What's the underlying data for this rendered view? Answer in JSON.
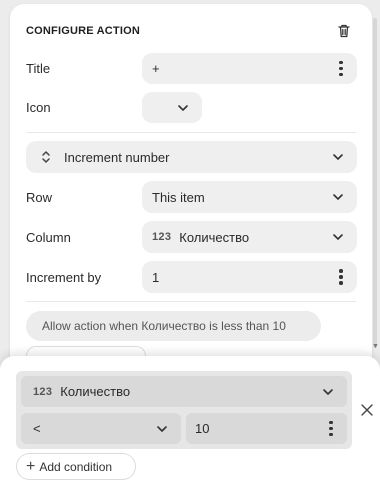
{
  "header": {
    "title": "CONFIGURE ACTION"
  },
  "form": {
    "title_label": "Title",
    "title_value": "+",
    "icon_label": "Icon",
    "action_type": "Increment number",
    "row_label": "Row",
    "row_value": "This item",
    "column_label": "Column",
    "column_type_icon": "123",
    "column_value": "Количество",
    "increment_label": "Increment by",
    "increment_value": "1",
    "condition_summary": "Allow action when Количество is less than 10"
  },
  "condition_popover": {
    "field_type_icon": "123",
    "field_value": "Количество",
    "operator": "<",
    "value": "10",
    "add_condition_label": "Add condition"
  }
}
